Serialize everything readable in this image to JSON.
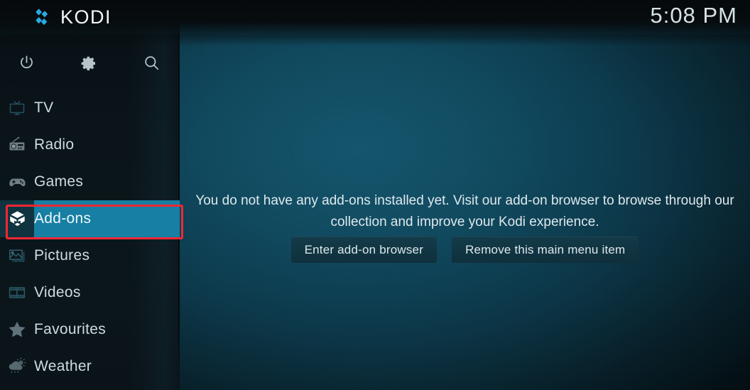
{
  "app": {
    "name": "KODI",
    "logo_icon": "kodi-logo-icon",
    "logo_color": "#29abe2"
  },
  "header": {
    "clock": "5:08 PM"
  },
  "toolbar": {
    "items": [
      {
        "name": "power",
        "icon": "power-icon",
        "label": "Power"
      },
      {
        "name": "settings",
        "icon": "gear-icon",
        "label": "Settings"
      },
      {
        "name": "search",
        "icon": "search-icon",
        "label": "Search"
      }
    ]
  },
  "sidebar": {
    "items": [
      {
        "label": "TV",
        "icon": "tv-icon",
        "selected": false
      },
      {
        "label": "Radio",
        "icon": "radio-icon",
        "selected": false
      },
      {
        "label": "Games",
        "icon": "gamepad-icon",
        "selected": false
      },
      {
        "label": "Add-ons",
        "icon": "addons-box-icon",
        "selected": true
      },
      {
        "label": "Pictures",
        "icon": "pictures-icon",
        "selected": false
      },
      {
        "label": "Videos",
        "icon": "filmstrip-icon",
        "selected": false
      },
      {
        "label": "Favourites",
        "icon": "star-icon",
        "selected": false
      },
      {
        "label": "Weather",
        "icon": "weather-icon",
        "selected": false
      }
    ],
    "highlight_color": "#167fa3"
  },
  "annotation": {
    "target": "Add-ons",
    "color": "#f32735"
  },
  "main": {
    "notice": "You do not have any add-ons installed yet. Visit our add-on browser to browse through our collection and improve your Kodi experience.",
    "buttons": [
      {
        "label": "Enter add-on browser"
      },
      {
        "label": "Remove this main menu item"
      }
    ]
  },
  "colors": {
    "accent": "#167fa3",
    "background": "#0e4257",
    "sidebar": "#0b1418",
    "annotation": "#f32735",
    "text": "#dfe9ed"
  }
}
